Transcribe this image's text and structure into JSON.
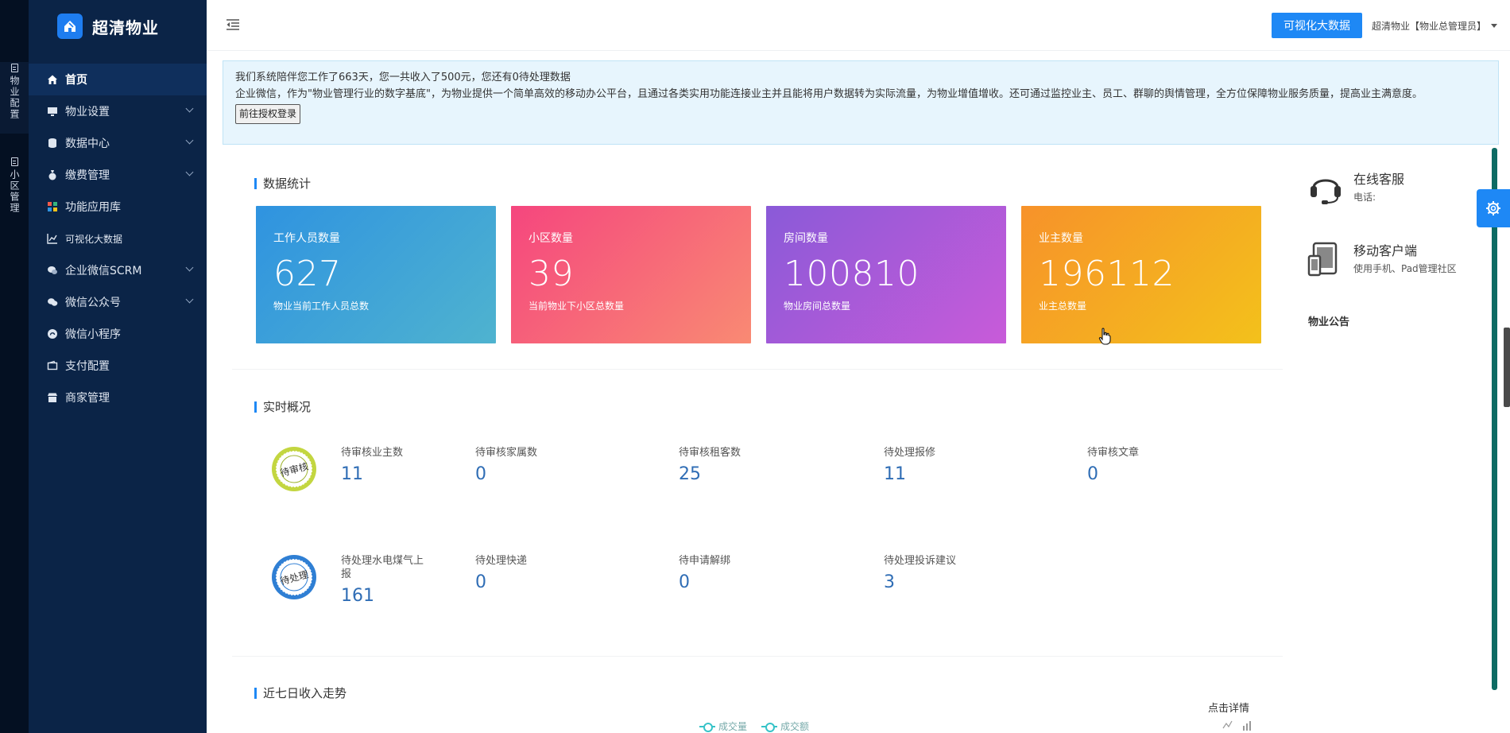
{
  "app": {
    "name": "超清物业"
  },
  "rail": [
    {
      "label": "物业配置"
    },
    {
      "label": "小区管理"
    }
  ],
  "sidebar": {
    "items": [
      {
        "label": "首页",
        "icon": "home-icon"
      },
      {
        "label": "物业设置",
        "icon": "monitor-icon"
      },
      {
        "label": "数据中心",
        "icon": "database-icon"
      },
      {
        "label": "缴费管理",
        "icon": "money-bag-icon"
      },
      {
        "label": "功能应用库",
        "icon": "apps-grid-icon"
      },
      {
        "label": "可视化大数据",
        "icon": "line-chart-icon"
      },
      {
        "label": "企业微信SCRM",
        "icon": "chat-icon"
      },
      {
        "label": "微信公众号",
        "icon": "wechat-icon"
      },
      {
        "label": "微信小程序",
        "icon": "miniprogram-icon"
      },
      {
        "label": "支付配置",
        "icon": "wallet-icon"
      },
      {
        "label": "商家管理",
        "icon": "store-icon"
      }
    ]
  },
  "header": {
    "bigdata_button": "可视化大数据",
    "user": "超清物业【物业总管理员】"
  },
  "notice": {
    "line1": "我们系统陪伴您工作了663天，您一共收入了500元，您还有0待处理数据",
    "line2": "企业微信，作为\"物业管理行业的数字基底\"，为物业提供一个简单高效的移动办公平台，且通过各类实用功能连接业主并且能将用户数据转为实际流量，为物业增值增收。还可通过监控业主、员工、群聊的舆情管理，全方位保障物业服务质量，提高业主满意度。",
    "button": "前往授权登录"
  },
  "stats": {
    "title": "数据统计",
    "cards": [
      {
        "label": "工作人员数量",
        "value": "627",
        "desc": "物业当前工作人员总数",
        "gradient": [
          "#2f93e0",
          "#4fb3cf"
        ]
      },
      {
        "label": "小区数量",
        "value": "39",
        "desc": "当前物业下小区总数量",
        "gradient": [
          "#f5467e",
          "#f98a73"
        ]
      },
      {
        "label": "房间数量",
        "value": "100810",
        "desc": "物业房间总数量",
        "gradient": [
          "#8a5ad8",
          "#c85bd9"
        ]
      },
      {
        "label": "业主数量",
        "value": "196112",
        "desc": "业主总数量",
        "gradient": [
          "#f7922a",
          "#f3c11b"
        ]
      }
    ]
  },
  "realtime": {
    "title": "实时概况",
    "badge1": "待审核",
    "badge2": "待处理",
    "row1": [
      {
        "label": "待审核业主数",
        "value": "11"
      },
      {
        "label": "待审核家属数",
        "value": "0"
      },
      {
        "label": "待审核租客数",
        "value": "25"
      },
      {
        "label": "待处理报修",
        "value": "11"
      },
      {
        "label": "待审核文章",
        "value": "0"
      }
    ],
    "row2": [
      {
        "label": "待处理水电煤气上报",
        "value": "161"
      },
      {
        "label": "待处理快递",
        "value": "0"
      },
      {
        "label": "待申请解绑",
        "value": "0"
      },
      {
        "label": "待处理投诉建议",
        "value": "3"
      }
    ]
  },
  "income": {
    "title": "近七日收入走势",
    "detail_link": "点击详情",
    "legend": [
      "成交量",
      "成交额"
    ]
  },
  "right_panel": {
    "service_title": "在线客服",
    "service_sub": "电话:",
    "mobile_title": "移动客户端",
    "mobile_sub": "使用手机、Pad管理社区",
    "announcement_title": "物业公告"
  },
  "colors": {
    "accent": "#1e88f5",
    "sidebar": "#0b2447",
    "value_blue": "#2f6db5"
  }
}
